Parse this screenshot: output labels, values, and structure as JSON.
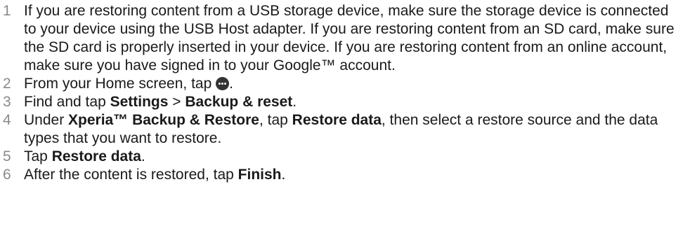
{
  "steps": [
    {
      "number": "1",
      "text": "If you are restoring content from a USB storage device, make sure the storage device is connected to your device using the USB Host adapter. If you are restoring content from an SD card, make sure the SD card is properly inserted in your device. If you are restoring content from an online account, make sure you have signed in to your Google™ account."
    },
    {
      "number": "2",
      "text_before": "From your Home screen, tap ",
      "icon": "apps-icon",
      "text_after": "."
    },
    {
      "number": "3",
      "text_1": "Find and tap ",
      "bold_1": "Settings",
      "text_2": " > ",
      "bold_2": "Backup & reset",
      "text_3": "."
    },
    {
      "number": "4",
      "text_1": "Under ",
      "bold_1": "Xperia™ Backup & Restore",
      "text_2": ", tap ",
      "bold_2": "Restore data",
      "text_3": ", then select a restore source and the data types that you want to restore."
    },
    {
      "number": "5",
      "text_1": "Tap ",
      "bold_1": "Restore data",
      "text_2": "."
    },
    {
      "number": "6",
      "text_1": "After the content is restored, tap ",
      "bold_1": "Finish",
      "text_2": "."
    }
  ]
}
